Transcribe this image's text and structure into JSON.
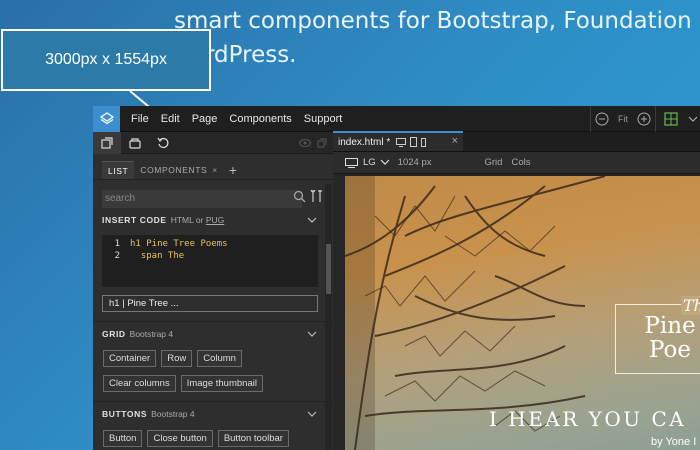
{
  "hero": {
    "line1": "smart components for Bootstrap, Foundation ar",
    "line2": "rdPress."
  },
  "callout": {
    "text": "3000px x 1554px"
  },
  "menubar": {
    "items": [
      "File",
      "Edit",
      "Page",
      "Components",
      "Support"
    ],
    "zoom_label": "Fit"
  },
  "left_panel": {
    "tabs": {
      "list": "LIST",
      "components": "COMPONENTS",
      "close": "×",
      "add": "+"
    },
    "search": {
      "placeholder": "search"
    },
    "insert_code": {
      "title": "INSERT CODE",
      "sub_prefix": "HTML or",
      "sub_link": "PUG",
      "lines": [
        {
          "num": "1",
          "text": "h1 Pine Tree Poems"
        },
        {
          "num": "2",
          "text": "  span The"
        }
      ]
    },
    "element_preview": "h1 | Pine Tree ...",
    "grid": {
      "title": "GRID",
      "sub": "Bootstrap 4",
      "row1": [
        "Container",
        "Row",
        "Column"
      ],
      "row2": [
        "Clear columns",
        "Image thumbnail"
      ]
    },
    "buttons": {
      "title": "BUTTONS",
      "sub": "Bootstrap 4",
      "row1": [
        "Button",
        "Close button",
        "Button toolbar"
      ]
    }
  },
  "right_panel": {
    "doc_tab": "index.html *",
    "doc_close": "×",
    "breakpoint": "LG",
    "width": "1024 px",
    "grid_toggle": "Grid",
    "cols_toggle": "Cols"
  },
  "preview": {
    "the": "Th",
    "title_line1": "Pine",
    "title_line2": "Poe",
    "subtitle": "I HEAR YOU CA",
    "byline": "by Yone I"
  },
  "colors": {
    "accent": "#3d8fd3",
    "code_text": "#e6c35c",
    "background_blue": "#2f8cc4"
  }
}
